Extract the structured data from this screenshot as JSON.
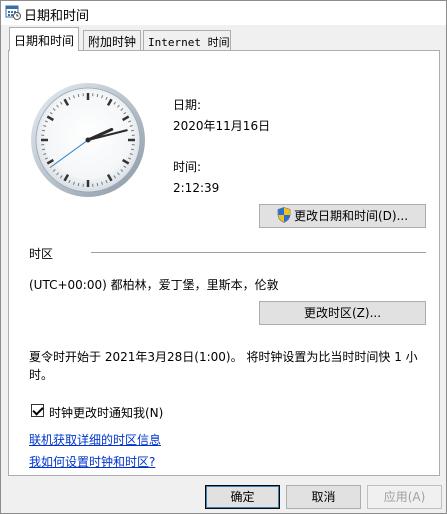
{
  "window": {
    "title": "日期和时间"
  },
  "tabs": [
    {
      "label": "日期和时间"
    },
    {
      "label": "附加时钟"
    },
    {
      "label": "Internet 时间"
    }
  ],
  "date": {
    "label": "日期:",
    "value": "2020年11月16日"
  },
  "time": {
    "label": "时间:",
    "value": "2:12:39"
  },
  "clock": {
    "hours": 2,
    "minutes": 12,
    "seconds": 39
  },
  "change_datetime_button": "更改日期和时间(D)...",
  "timezone": {
    "section_label": "时区",
    "value": "(UTC+00:00) 都柏林，爱丁堡，里斯本，伦敦",
    "change_button": "更改时区(Z)..."
  },
  "dst": {
    "line1": "夏令时开始于 2021年3月28日(1:00)。 将时钟设置为比当时时间快 1 小",
    "line2": "时。"
  },
  "notify": {
    "label": "时钟更改时通知我(N)",
    "checked": true
  },
  "links": {
    "online_info": "联机获取详细的时区信息",
    "how_to_set": "我如何设置时钟和时区?"
  },
  "footer": {
    "ok": "确定",
    "cancel": "取消",
    "apply": "应用(A)"
  }
}
